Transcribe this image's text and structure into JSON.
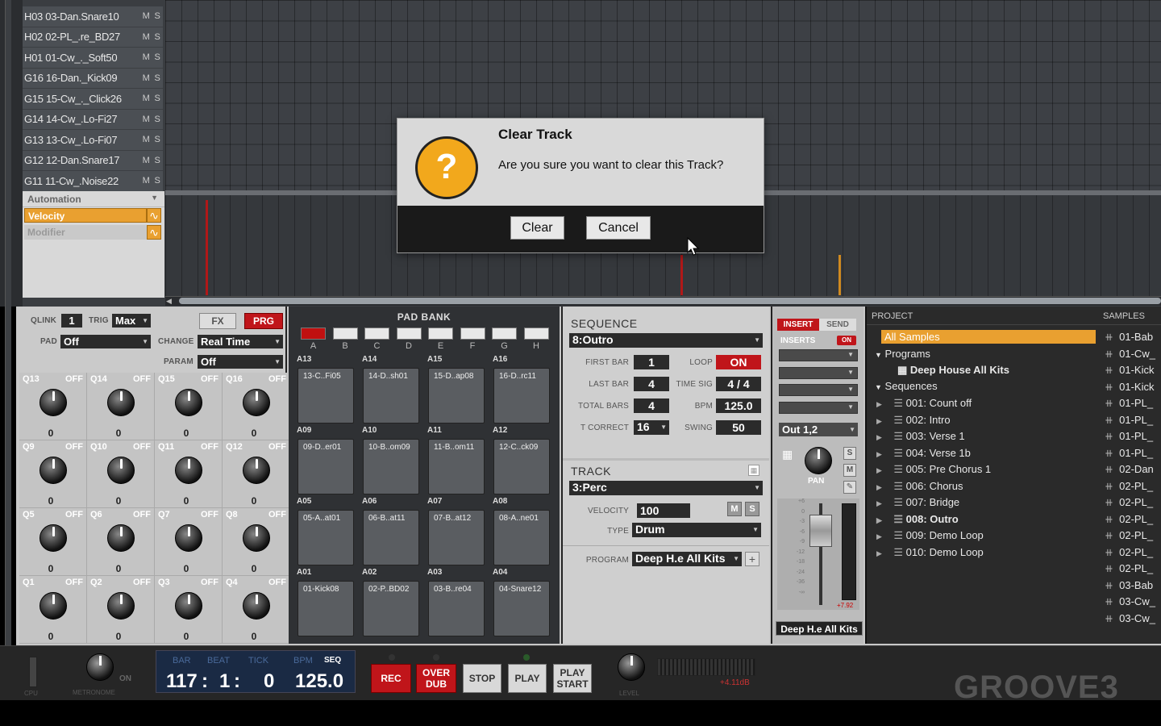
{
  "tracks": [
    {
      "label": "H03 03-Dan.Snare10",
      "m": "M",
      "s": "S"
    },
    {
      "label": "H02 02-PL_.re_BD27",
      "m": "M",
      "s": "S"
    },
    {
      "label": "H01 01-Cw_._Soft50",
      "m": "M",
      "s": "S"
    },
    {
      "label": "G16 16-Dan._Kick09",
      "m": "M",
      "s": "S"
    },
    {
      "label": "G15 15-Cw_._Click26",
      "m": "M",
      "s": "S"
    },
    {
      "label": "G14 14-Cw_.Lo-Fi27",
      "m": "M",
      "s": "S"
    },
    {
      "label": "G13 13-Cw_.Lo-Fi07",
      "m": "M",
      "s": "S"
    },
    {
      "label": "G12 12-Dan.Snare17",
      "m": "M",
      "s": "S"
    },
    {
      "label": "G11 11-Cw_.Noise22",
      "m": "M",
      "s": "S"
    }
  ],
  "automation": {
    "header": "Automation",
    "options": [
      "Velocity",
      "Modifier"
    ],
    "selected": "Velocity"
  },
  "dialog": {
    "title": "Clear Track",
    "message": "Are you sure you want to clear this Track?",
    "icon": "question-icon",
    "clear_label": "Clear",
    "cancel_label": "Cancel"
  },
  "qlink": {
    "qlink_label": "QLINK",
    "qlink_value": "1",
    "trig_label": "TRIG",
    "trig_value": "Max",
    "fx_label": "FX",
    "prg_label": "PRG",
    "pad_label": "PAD",
    "pad_value": "Off",
    "change_label": "CHANGE",
    "change_value": "Real Time",
    "param_label": "PARAM",
    "param_value": "Off",
    "knobs": [
      {
        "name": "Q13",
        "state": "OFF",
        "value": "0"
      },
      {
        "name": "Q14",
        "state": "OFF",
        "value": "0"
      },
      {
        "name": "Q15",
        "state": "OFF",
        "value": "0"
      },
      {
        "name": "Q16",
        "state": "OFF",
        "value": "0"
      },
      {
        "name": "Q9",
        "state": "OFF",
        "value": "0"
      },
      {
        "name": "Q10",
        "state": "OFF",
        "value": "0"
      },
      {
        "name": "Q11",
        "state": "OFF",
        "value": "0"
      },
      {
        "name": "Q12",
        "state": "OFF",
        "value": "0"
      },
      {
        "name": "Q5",
        "state": "OFF",
        "value": "0"
      },
      {
        "name": "Q6",
        "state": "OFF",
        "value": "0"
      },
      {
        "name": "Q7",
        "state": "OFF",
        "value": "0"
      },
      {
        "name": "Q8",
        "state": "OFF",
        "value": "0"
      },
      {
        "name": "Q1",
        "state": "OFF",
        "value": "0"
      },
      {
        "name": "Q2",
        "state": "OFF",
        "value": "0"
      },
      {
        "name": "Q3",
        "state": "OFF",
        "value": "0"
      },
      {
        "name": "Q4",
        "state": "OFF",
        "value": "0"
      }
    ]
  },
  "padbank": {
    "title": "PAD BANK",
    "banks": [
      "A",
      "B",
      "C",
      "D",
      "E",
      "F",
      "G",
      "H"
    ],
    "selected_bank": "A",
    "pads": [
      {
        "id": "A13",
        "label": "13-C..Fi05"
      },
      {
        "id": "A14",
        "label": "14-D..sh01"
      },
      {
        "id": "A15",
        "label": "15-D..ap08"
      },
      {
        "id": "A16",
        "label": "16-D..rc11"
      },
      {
        "id": "A09",
        "label": "09-D..er01"
      },
      {
        "id": "A10",
        "label": "10-B..om09"
      },
      {
        "id": "A11",
        "label": "11-B..om11"
      },
      {
        "id": "A12",
        "label": "12-C..ck09"
      },
      {
        "id": "A05",
        "label": "05-A..at01"
      },
      {
        "id": "A06",
        "label": "06-B..at11"
      },
      {
        "id": "A07",
        "label": "07-B..at12"
      },
      {
        "id": "A08",
        "label": "08-A..ne01"
      },
      {
        "id": "A01",
        "label": "01-Kick08"
      },
      {
        "id": "A02",
        "label": "02-P..BD02"
      },
      {
        "id": "A03",
        "label": "03-B..re04"
      },
      {
        "id": "A04",
        "label": "04-Snare12"
      }
    ]
  },
  "sequence": {
    "header": "SEQUENCE",
    "name": "8:Outro",
    "first_bar_label": "FIRST BAR",
    "first_bar": "1",
    "loop_label": "LOOP",
    "loop": "ON",
    "last_bar_label": "LAST BAR",
    "last_bar": "4",
    "time_sig_label": "TIME SIG",
    "time_sig": "4 / 4",
    "total_bars_label": "TOTAL BARS",
    "total_bars": "4",
    "bpm_label": "BPM",
    "bpm": "125.0",
    "t_correct_label": "T CORRECT",
    "t_correct": "16",
    "swing_label": "SWING",
    "swing": "50"
  },
  "track": {
    "header": "TRACK",
    "name": "3:Perc",
    "velocity_label": "VELOCITY",
    "velocity": "100",
    "m": "M",
    "s": "S",
    "type_label": "TYPE",
    "type": "Drum",
    "program_label": "PROGRAM",
    "program": "Deep H.e All Kits"
  },
  "mixer": {
    "insert_label": "INSERT",
    "send_label": "SEND",
    "inserts_label": "INSERTS",
    "inserts_on": "ON",
    "output": "Out 1,2",
    "pan_label": "PAN",
    "s": "S",
    "m": "M",
    "scale": [
      "+6",
      "0",
      "-3",
      "-6",
      "-9",
      "-12",
      "-18",
      "-24",
      "-36",
      "-∞"
    ],
    "peak": "+7.92",
    "name": "Deep H.e All Kits"
  },
  "project": {
    "header": "PROJECT",
    "samples_header": "SAMPLES",
    "all_samples": "All Samples",
    "programs": "Programs",
    "program_item": "Deep House All Kits",
    "sequences_label": "Sequences",
    "sequences": [
      "001: Count off",
      "002: Intro",
      "003: Verse 1",
      "004: Verse 1b",
      "005: Pre Chorus 1",
      "006: Chorus",
      "007: Bridge",
      "008: Outro",
      "009: Demo Loop",
      "010: Demo Loop"
    ],
    "selected_sequence": "008: Outro",
    "samples": [
      "01-Bab",
      "01-Cw_",
      "01-Kick",
      "01-Kick",
      "01-PL_",
      "01-PL_",
      "01-PL_",
      "01-PL_",
      "02-Dan",
      "02-PL_",
      "02-PL_",
      "02-PL_",
      "02-PL_",
      "02-PL_",
      "02-PL_",
      "03-Bab",
      "03-Cw_",
      "03-Cw_"
    ]
  },
  "transport": {
    "cpu_label": "CPU",
    "metronome_label": "METRONOME",
    "metronome_on": "ON",
    "bar_label": "BAR",
    "beat_label": "BEAT",
    "tick_label": "TICK",
    "bpm_label": "BPM",
    "seq_label": "SEQ",
    "bar": "117",
    "beat": "1",
    "tick": "0",
    "bpm": "125.0",
    "rec": "REC",
    "overdub": "OVER DUB",
    "stop": "STOP",
    "play": "PLAY",
    "play_start": "PLAY START",
    "level_label": "LEVEL",
    "level_db": "+4.11dB",
    "watermark": "GROOVE3"
  },
  "colors": {
    "accent": "#e9a030",
    "rec": "#c0151a",
    "dialog_icon": "#f2a81c",
    "lcd": "#1a2a44"
  }
}
